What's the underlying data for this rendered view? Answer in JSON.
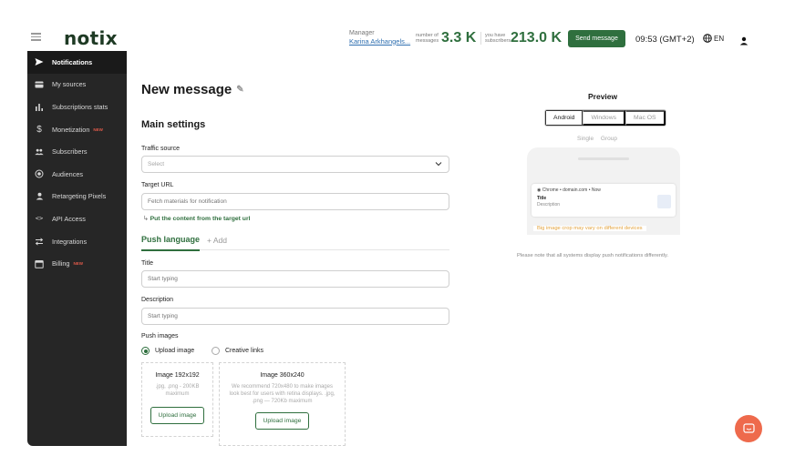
{
  "header": {
    "logo": "notix",
    "manager_label": "Manager",
    "manager_name": "Karina Arkhangels...",
    "messages_label": "number of messages",
    "messages_value": "3.3 K",
    "subscribers_label": "you have subscribers",
    "subscribers_value": "213.0 K",
    "send_button": "Send message",
    "time": "09:53 (GMT+2)",
    "language": "EN",
    "accent_color": "#2f6f3e"
  },
  "sidebar": {
    "items": [
      {
        "label": "Notifications",
        "icon": "send-icon",
        "active": true,
        "badge": ""
      },
      {
        "label": "My sources",
        "icon": "card-icon",
        "active": false,
        "badge": ""
      },
      {
        "label": "Subscriptions stats",
        "icon": "bar-chart-icon",
        "active": false,
        "badge": ""
      },
      {
        "label": "Monetization",
        "icon": "dollar-icon",
        "active": false,
        "badge": "NEW"
      },
      {
        "label": "Subscribers",
        "icon": "people-icon",
        "active": false,
        "badge": ""
      },
      {
        "label": "Audiences",
        "icon": "target-icon",
        "active": false,
        "badge": ""
      },
      {
        "label": "Retargeting Pixels",
        "icon": "person-icon",
        "active": false,
        "badge": ""
      },
      {
        "label": "API Access",
        "icon": "code-icon",
        "active": false,
        "badge": ""
      },
      {
        "label": "Integrations",
        "icon": "arrows-icon",
        "active": false,
        "badge": ""
      },
      {
        "label": "Billing",
        "icon": "calendar-icon",
        "active": false,
        "badge": "NEW"
      }
    ]
  },
  "main": {
    "title": "New message",
    "section_title": "Main settings",
    "traffic_source_label": "Traffic source",
    "traffic_source_value": "Select",
    "target_url_label": "Target URL",
    "target_url_placeholder": "Fetch materials for notification",
    "put_content_link": "Put the content from the target url",
    "tab_push_language": "Push language",
    "tab_add": "+ Add",
    "title_label": "Title",
    "title_placeholder": "Start typing",
    "description_label": "Description",
    "description_placeholder": "Start typing",
    "push_images_label": "Push images",
    "radio_upload": "Upload image",
    "radio_creative": "Creative links",
    "image1_title": "Image 192x192",
    "image1_desc": ".jpg, .png - 200KB maximum",
    "image1_button": "Upload image",
    "image2_title": "Image 360x240",
    "image2_desc": "We recommend 720x480 to make images look best for users with retina displays. .jpg, .png — 720Kb maximum",
    "image2_button": "Upload image"
  },
  "preview": {
    "title": "Preview",
    "tabs": [
      "Android",
      "Windows",
      "Mac OS"
    ],
    "selected_tab": "Android",
    "sub_single": "Single",
    "sub_group": "Group",
    "notif_source": "Chrome • domain.com • Now",
    "notif_title": "Title",
    "notif_desc": "Description",
    "warning": "Big image crop may vary on different devices",
    "note": "Please note that all systems display push notifications differently."
  }
}
